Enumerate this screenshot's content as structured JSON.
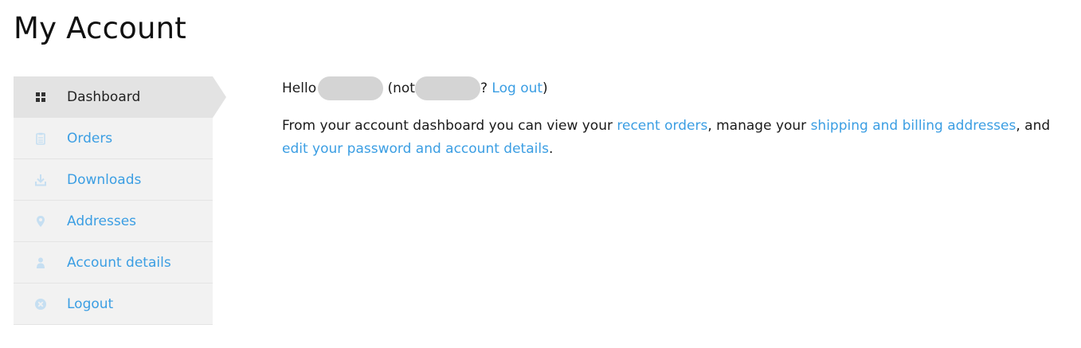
{
  "page": {
    "title": "My Account"
  },
  "sidebar": {
    "items": [
      {
        "label": "Dashboard",
        "icon": "dashboard-icon",
        "active": true
      },
      {
        "label": "Orders",
        "icon": "orders-icon",
        "active": false
      },
      {
        "label": "Downloads",
        "icon": "downloads-icon",
        "active": false
      },
      {
        "label": "Addresses",
        "icon": "map-pin-icon",
        "active": false
      },
      {
        "label": "Account details",
        "icon": "user-icon",
        "active": false
      },
      {
        "label": "Logout",
        "icon": "logout-icon",
        "active": false
      }
    ]
  },
  "greeting": {
    "hello": "Hello",
    "not": "(not",
    "question": "?",
    "logout_link": "Log out",
    "close_paren": ")"
  },
  "intro": {
    "text1": "From your account dashboard you can view your ",
    "link_orders": "recent orders",
    "text2": ", manage your ",
    "link_addresses": "shipping and billing addresses",
    "text3": ", and ",
    "link_account": "edit your password and account details",
    "text4": "."
  },
  "colors": {
    "link": "#3b9ee3",
    "sidebar_bg": "#f2f2f2",
    "sidebar_active_bg": "#e3e3e3",
    "icon_inactive": "#c6dff2",
    "redaction": "#d4d4d4"
  }
}
